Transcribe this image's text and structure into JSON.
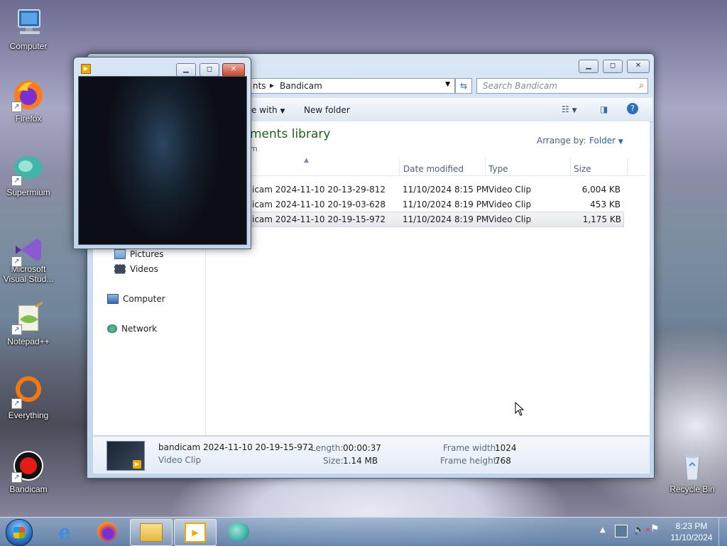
{
  "desktop": {
    "icons": [
      {
        "label": "Computer"
      },
      {
        "label": "Firefox"
      },
      {
        "label": "Supermium"
      },
      {
        "label": "Microsoft Visual Stud..."
      },
      {
        "label": "Notepad++"
      },
      {
        "label": "Everything"
      },
      {
        "label": "Bandicam"
      },
      {
        "label": "Recycle Bin"
      }
    ]
  },
  "explorer": {
    "breadcrumb": {
      "parent": "nts",
      "current": "Bandicam"
    },
    "search_placeholder": "Search Bandicam",
    "toolbar": {
      "share_with": "e with",
      "new_folder": "New folder"
    },
    "library": {
      "title": "ments library",
      "subtitle": "m",
      "arrange_label": "Arrange by:",
      "arrange_value": "Folder"
    },
    "columns": {
      "modified": "Date modified",
      "type": "Type",
      "size": "Size"
    },
    "files": [
      {
        "name": "icam 2024-11-10 20-13-29-812",
        "modified": "11/10/2024 8:15 PM",
        "type": "Video Clip",
        "size": "6,004 KB"
      },
      {
        "name": "icam 2024-11-10 20-19-03-628",
        "modified": "11/10/2024 8:19 PM",
        "type": "Video Clip",
        "size": "453 KB"
      },
      {
        "name": "icam 2024-11-10 20-19-15-972",
        "modified": "11/10/2024 8:19 PM",
        "type": "Video Clip",
        "size": "1,175 KB"
      }
    ],
    "nav": {
      "pictures": "Pictures",
      "videos": "Videos",
      "computer": "Computer",
      "network": "Network"
    },
    "details": {
      "filename": "bandicam 2024-11-10 20-19-15-972",
      "filetype": "Video Clip",
      "length_label": "Length:",
      "length_value": "00:00:37",
      "size_label": "Size:",
      "size_value": "1.14 MB",
      "frame_width_label": "Frame width:",
      "frame_width_value": "1024",
      "frame_height_label": "Frame height:",
      "frame_height_value": "768"
    }
  },
  "taskbar": {
    "time": "8:23 PM",
    "date": "11/10/2024"
  }
}
